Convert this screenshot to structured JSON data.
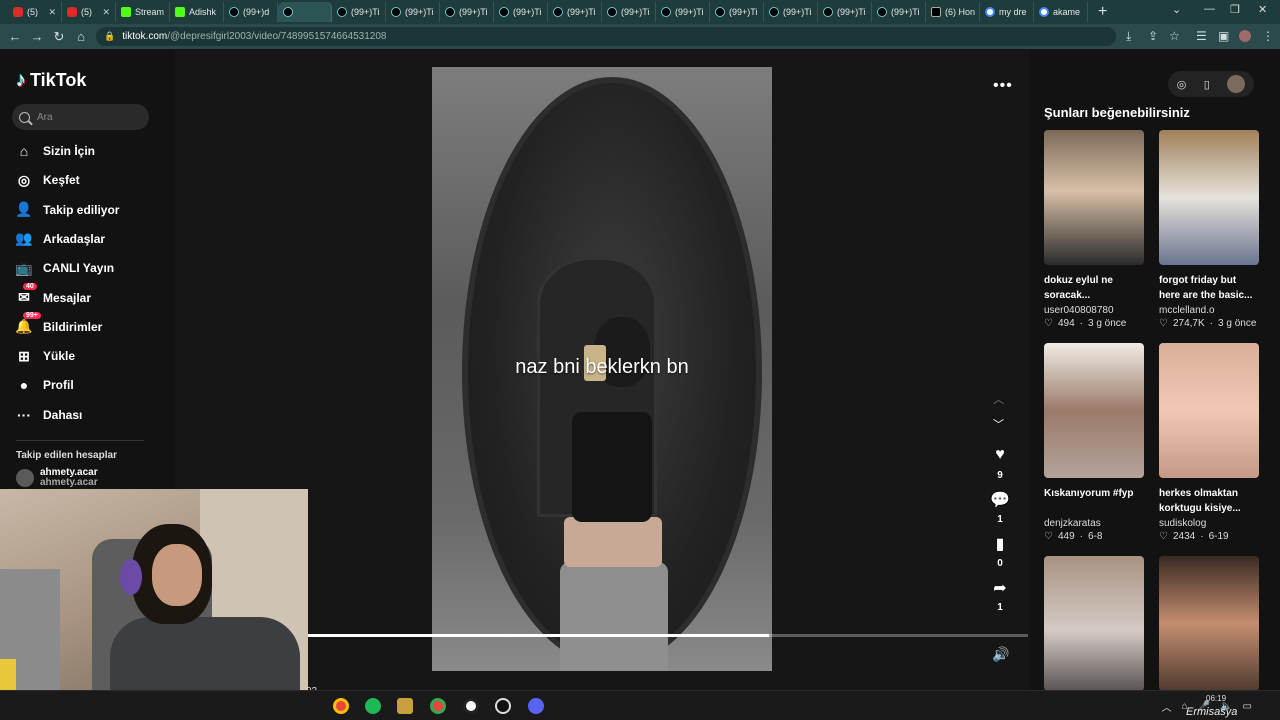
{
  "browser": {
    "tabs": [
      {
        "label": "(5)",
        "icon": "youtube",
        "color": "#e02a2a"
      },
      {
        "label": "(5)",
        "icon": "youtube",
        "color": "#e02a2a"
      },
      {
        "label": "Stream",
        "icon": "kick",
        "color": "#53fc18"
      },
      {
        "label": "Adishk",
        "icon": "kick",
        "color": "#53fc18"
      },
      {
        "label": "(99+)d",
        "icon": "tiktok",
        "color": "#000000"
      },
      {
        "label": "",
        "icon": "tiktok",
        "color": "#000000",
        "active": true
      },
      {
        "label": "(99+)Ti",
        "icon": "tiktok",
        "color": "#000000"
      },
      {
        "label": "(99+)Ti",
        "icon": "tiktok",
        "color": "#000000"
      },
      {
        "label": "(99+)Ti",
        "icon": "tiktok",
        "color": "#000000"
      },
      {
        "label": "(99+)Ti",
        "icon": "tiktok",
        "color": "#000000"
      },
      {
        "label": "(99+)Ti",
        "icon": "tiktok",
        "color": "#000000"
      },
      {
        "label": "(99+)Ti",
        "icon": "tiktok",
        "color": "#000000"
      },
      {
        "label": "(99+)Ti",
        "icon": "tiktok",
        "color": "#000000"
      },
      {
        "label": "(99+)Ti",
        "icon": "tiktok",
        "color": "#000000"
      },
      {
        "label": "(99+)Ti",
        "icon": "tiktok",
        "color": "#000000"
      },
      {
        "label": "(99+)Ti",
        "icon": "tiktok",
        "color": "#000000"
      },
      {
        "label": "(99+)Ti",
        "icon": "tiktok",
        "color": "#000000"
      },
      {
        "label": "(6) Hon",
        "icon": "x",
        "color": "#000000"
      },
      {
        "label": "my dre",
        "icon": "google",
        "color": "#4285f4"
      },
      {
        "label": "akame",
        "icon": "google",
        "color": "#4285f4"
      }
    ],
    "url_host": "tiktok.com",
    "url_path": "/@depresifgirl2003/video/7489951574664531208"
  },
  "tiktok": {
    "logo_text": "TikTok",
    "search_placeholder": "Ara",
    "nav": [
      {
        "label": "Sizin İçin",
        "icon": "home-icon"
      },
      {
        "label": "Keşfet",
        "icon": "compass-icon"
      },
      {
        "label": "Takip ediliyor",
        "icon": "user-follow-icon"
      },
      {
        "label": "Arkadaşlar",
        "icon": "friends-icon"
      },
      {
        "label": "CANLI Yayın",
        "icon": "live-tv-icon"
      },
      {
        "label": "Mesajlar",
        "icon": "message-icon",
        "badge": "40"
      },
      {
        "label": "Bildirimler",
        "icon": "bell-icon",
        "badge": "99+"
      },
      {
        "label": "Yükle",
        "icon": "upload-icon"
      },
      {
        "label": "Profil",
        "icon": "profile-icon"
      },
      {
        "label": "Dahası",
        "icon": "more-icon"
      }
    ],
    "following_title": "Takip edilen hesaplar",
    "following_account": "ahmety.acar",
    "following_account_2": "ahmety.acar"
  },
  "video": {
    "overlay_text": "naz bni beklerkn bn",
    "likes": "9",
    "comments": "1",
    "saves": "0",
    "shares": "1",
    "progress_fraction": 0.64,
    "partial_label": "03"
  },
  "recommend": {
    "title": "Şunları beğenebilirsiniz",
    "cards": [
      {
        "caption": "dokuz eylul ne soracak...",
        "user": "user040808780",
        "likes": "494",
        "age": "3 g önce"
      },
      {
        "caption": "forgot friday but here are the basic...",
        "user": "mcclelland.o",
        "likes": "274,7K",
        "age": "3 g önce"
      },
      {
        "caption": "Kıskanıyorum #fyp",
        "user": "denjzkaratas",
        "likes": "449",
        "age": "6-8"
      },
      {
        "caption": "herkes olmaktan korktugu kisiye...",
        "user": "sudiskolog",
        "likes": "2434",
        "age": "6-19"
      },
      {
        "caption": "",
        "user": "",
        "likes": "",
        "age": ""
      },
      {
        "caption": "",
        "user": "",
        "likes": "",
        "age": ""
      }
    ]
  },
  "taskbar": {
    "time": "06:19",
    "date": "",
    "watermark": "Ermisasya"
  }
}
